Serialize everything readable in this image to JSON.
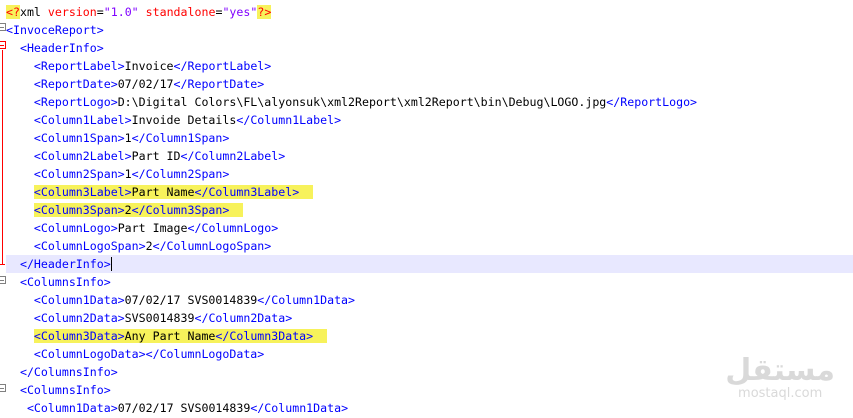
{
  "editor": {
    "lines": [
      {
        "segments": [
          [
            "pi",
            "<?"
          ],
          [
            "x",
            "xml "
          ],
          [
            "a",
            "version"
          ],
          [
            "x",
            "="
          ],
          [
            "v",
            "\"1.0\""
          ],
          [
            "x",
            " "
          ],
          [
            "a",
            "standalone"
          ],
          [
            "x",
            "="
          ],
          [
            "v",
            "\"yes\""
          ],
          [
            "pi",
            "?>"
          ]
        ]
      },
      {
        "segments": [
          [
            "t",
            "<InvoceReport>"
          ]
        ]
      },
      {
        "segments": [
          [
            "x",
            "  "
          ],
          [
            "t",
            "<HeaderInfo>"
          ]
        ]
      },
      {
        "segments": [
          [
            "x",
            "    "
          ],
          [
            "t",
            "<ReportLabel>"
          ],
          [
            "x",
            "Invoice"
          ],
          [
            "t",
            "</ReportLabel>"
          ]
        ]
      },
      {
        "segments": [
          [
            "x",
            "    "
          ],
          [
            "t",
            "<ReportDate>"
          ],
          [
            "x",
            "07/02/17"
          ],
          [
            "t",
            "</ReportDate>"
          ]
        ]
      },
      {
        "segments": [
          [
            "x",
            "    "
          ],
          [
            "t",
            "<ReportLogo>"
          ],
          [
            "x",
            "D:\\Digital Colors\\FL\\alyonsuk\\xml2Report\\xml2Report\\bin\\Debug\\LOGO.jpg"
          ],
          [
            "t",
            "</ReportLogo>"
          ]
        ]
      },
      {
        "segments": [
          [
            "x",
            "    "
          ],
          [
            "t",
            "<Column1Label>"
          ],
          [
            "x",
            "Invoide Details"
          ],
          [
            "t",
            "</Column1Label>"
          ]
        ]
      },
      {
        "segments": [
          [
            "x",
            "    "
          ],
          [
            "t",
            "<Column1Span>"
          ],
          [
            "x",
            "1"
          ],
          [
            "t",
            "</Column1Span>"
          ]
        ]
      },
      {
        "segments": [
          [
            "x",
            "    "
          ],
          [
            "t",
            "<Column2Label>"
          ],
          [
            "x",
            "Part ID"
          ],
          [
            "t",
            "</Column2Label>"
          ]
        ]
      },
      {
        "segments": [
          [
            "x",
            "    "
          ],
          [
            "t",
            "<Column2Span>"
          ],
          [
            "x",
            "1"
          ],
          [
            "t",
            "</Column2Span>"
          ]
        ]
      },
      {
        "segments": [
          [
            "x",
            "    "
          ],
          [
            "t",
            "<Column3Label>"
          ],
          [
            "x",
            "Part Name"
          ],
          [
            "t",
            "</Column3Label>"
          ]
        ],
        "highlight": true
      },
      {
        "segments": [
          [
            "x",
            "    "
          ],
          [
            "t",
            "<Column3Span>"
          ],
          [
            "x",
            "2"
          ],
          [
            "t",
            "</Column3Span>"
          ]
        ],
        "highlight": true
      },
      {
        "segments": [
          [
            "x",
            "    "
          ],
          [
            "t",
            "<ColumnLogo>"
          ],
          [
            "x",
            "Part Image"
          ],
          [
            "t",
            "</ColumnLogo>"
          ]
        ]
      },
      {
        "segments": [
          [
            "x",
            "    "
          ],
          [
            "t",
            "<ColumnLogoSpan>"
          ],
          [
            "x",
            "2"
          ],
          [
            "t",
            "</ColumnLogoSpan>"
          ]
        ]
      },
      {
        "segments": [
          [
            "x",
            "  "
          ],
          [
            "t",
            "</HeaderInfo>"
          ]
        ],
        "current": true,
        "caret": true
      },
      {
        "segments": [
          [
            "x",
            "  "
          ],
          [
            "t",
            "<ColumnsInfo>"
          ]
        ]
      },
      {
        "segments": [
          [
            "x",
            "    "
          ],
          [
            "t",
            "<Column1Data>"
          ],
          [
            "x",
            "07/02/17 SVS0014839"
          ],
          [
            "t",
            "</Column1Data>"
          ]
        ]
      },
      {
        "segments": [
          [
            "x",
            "    "
          ],
          [
            "t",
            "<Column2Data>"
          ],
          [
            "x",
            "SVS0014839"
          ],
          [
            "t",
            "</Column2Data>"
          ]
        ]
      },
      {
        "segments": [
          [
            "x",
            "    "
          ],
          [
            "t",
            "<Column3Data>"
          ],
          [
            "x",
            "Any Part Name"
          ],
          [
            "t",
            "</Column3Data>"
          ]
        ],
        "highlight": true
      },
      {
        "segments": [
          [
            "x",
            "    "
          ],
          [
            "t",
            "<ColumnLogoData>"
          ],
          [
            "t",
            "</ColumnLogoData>"
          ]
        ]
      },
      {
        "segments": [
          [
            "x",
            "  "
          ],
          [
            "t",
            "</ColumnsInfo>"
          ]
        ]
      },
      {
        "segments": [
          [
            "x",
            "  "
          ],
          [
            "t",
            "<ColumnsInfo>"
          ]
        ]
      },
      {
        "segments": [
          [
            "x",
            "   "
          ],
          [
            "t",
            "<Column1Data>"
          ],
          [
            "x",
            "07/02/17 SVS0014839"
          ],
          [
            "t",
            "</Column1Data>"
          ]
        ]
      }
    ]
  },
  "watermark": {
    "logo": "مستقل",
    "site": "mostaql.com"
  },
  "colors": {
    "tag": "#0000ff",
    "text": "#000000",
    "attr": "#ff0000",
    "value": "#8000ff",
    "highlight": "#f7f25b",
    "current_line": "#e8e8ff"
  }
}
